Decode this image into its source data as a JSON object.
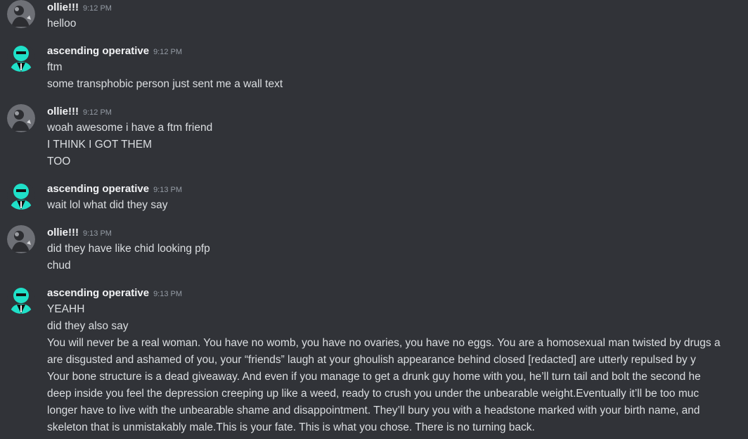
{
  "messages": [
    {
      "author": "ollie!!!",
      "avatar": "ollie-avatar",
      "time": "9:12 PM",
      "lines": [
        "helloo"
      ]
    },
    {
      "author": "ascending operative",
      "avatar": "operative-avatar",
      "time": "9:12 PM",
      "lines": [
        "ftm",
        "some transphobic person just sent me a wall text"
      ]
    },
    {
      "author": "ollie!!!",
      "avatar": "ollie-avatar",
      "time": "9:12 PM",
      "lines": [
        "woah awesome i have a ftm friend",
        "I THINK I GOT THEM",
        "TOO"
      ]
    },
    {
      "author": "ascending operative",
      "avatar": "operative-avatar",
      "time": "9:13 PM",
      "lines": [
        "wait lol what did they say"
      ]
    },
    {
      "author": "ollie!!!",
      "avatar": "ollie-avatar",
      "time": "9:13 PM",
      "lines": [
        "did they have like chid looking pfp",
        "chud"
      ]
    },
    {
      "author": "ascending operative",
      "avatar": "operative-avatar",
      "time": "9:13 PM",
      "lines": [
        "YEAHH",
        "did they also say",
        "You will never be a real woman. You have no womb, you have no ovaries, you have no eggs. You are a homosexual man twisted by drugs a",
        "are disgusted and ashamed of you, your “friends” laugh at your ghoulish appearance behind closed [redacted] are utterly repulsed by y",
        "Your bone structure is a dead giveaway. And even if you manage to get a drunk guy home with you, he’ll turn tail and bolt the second he",
        "deep inside you feel the depression creeping up like a weed, ready to crush you under the unbearable weight.Eventually it’ll be too muc",
        "longer have to live with the unbearable shame and disappointment. They’ll bury you with a headstone marked with your birth name, and",
        "skeleton that is unmistakably male.This is your fate. This is what you chose. There is no turning back."
      ]
    }
  ],
  "colors": {
    "background": "#313338",
    "username": "#f2f3f5",
    "timestamp": "#949ba4",
    "message_text": "#dbdee1",
    "operative_avatar_bg": "#1fe0c8"
  }
}
